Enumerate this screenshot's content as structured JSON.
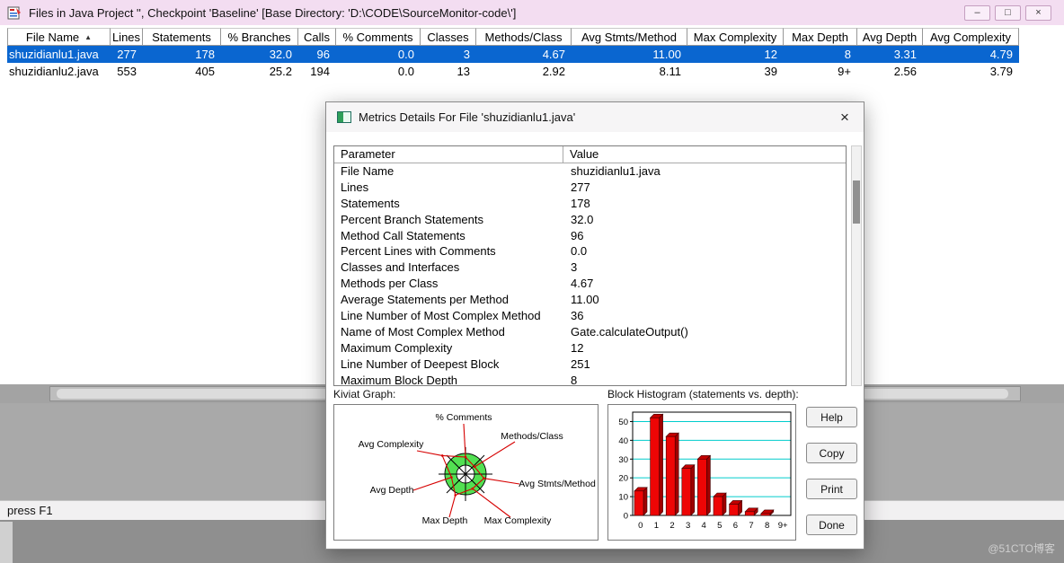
{
  "window": {
    "title": "Files in Java Project '', Checkpoint 'Baseline'  [Base Directory: 'D:\\CODE\\SourceMonitor-code\\']",
    "status": "press F1",
    "controls": {
      "minimize": "–",
      "maximize": "□",
      "close": "×"
    }
  },
  "icons": {
    "dialog_close": "×"
  },
  "file_table": {
    "sort_indicator": "▲",
    "columns": [
      "File Name",
      "Lines",
      "Statements",
      "% Branches",
      "Calls",
      "% Comments",
      "Classes",
      "Methods/Class",
      "Avg Stmts/Method",
      "Max Complexity",
      "Max Depth",
      "Avg Depth",
      "Avg Complexity"
    ],
    "rows": [
      {
        "selected": true,
        "cells": [
          "shuzidianlu1.java",
          "277",
          "178",
          "32.0",
          "96",
          "0.0",
          "3",
          "4.67",
          "11.00",
          "12",
          "8",
          "3.31",
          "4.79"
        ]
      },
      {
        "selected": false,
        "cells": [
          "shuzidianlu2.java",
          "553",
          "405",
          "25.2",
          "194",
          "0.0",
          "13",
          "2.92",
          "8.11",
          "39",
          "9+",
          "2.56",
          "3.79"
        ]
      }
    ]
  },
  "dialog": {
    "title": "Metrics Details For File 'shuzidianlu1.java'",
    "param_table": {
      "columns": [
        "Parameter",
        "Value"
      ],
      "rows": [
        [
          "File Name",
          "shuzidianlu1.java"
        ],
        [
          "Lines",
          "277"
        ],
        [
          "Statements",
          "178"
        ],
        [
          "Percent Branch Statements",
          "32.0"
        ],
        [
          "Method Call Statements",
          "96"
        ],
        [
          "Percent Lines with Comments",
          "0.0"
        ],
        [
          "Classes and Interfaces",
          "3"
        ],
        [
          "Methods per Class",
          "4.67"
        ],
        [
          "Average Statements per Method",
          "11.00"
        ],
        [
          "Line Number of Most Complex Method",
          "36"
        ],
        [
          "Name of Most Complex Method",
          "Gate.calculateOutput()"
        ],
        [
          "Maximum Complexity",
          "12"
        ],
        [
          "Line Number of Deepest Block",
          "251"
        ],
        [
          "Maximum Block Depth",
          "8"
        ]
      ]
    },
    "kiviat": {
      "label": "Kiviat Graph:",
      "axes": [
        "% Comments",
        "Methods/Class",
        "Avg Stmts/Method",
        "Max Complexity",
        "Max Depth",
        "Avg Depth",
        "Avg Complexity"
      ]
    },
    "histogram": {
      "label": "Block Histogram (statements vs. depth):"
    },
    "buttons": [
      "Help",
      "Copy",
      "Print",
      "Done"
    ]
  },
  "chart_data": {
    "type": "bar",
    "title": "Block Histogram (statements vs. depth)",
    "categories": [
      "0",
      "1",
      "2",
      "3",
      "4",
      "5",
      "6",
      "7",
      "8",
      "9+"
    ],
    "values": [
      13,
      52,
      42,
      25,
      30,
      10,
      6,
      2,
      1,
      0
    ],
    "xlabel": "",
    "ylabel": "",
    "ylim": [
      0,
      55
    ],
    "yticks": [
      0,
      10,
      20,
      30,
      40,
      50
    ],
    "bar_color": "#ee0505",
    "grid_color": "#00cccc",
    "grid": "horizontal"
  },
  "watermark": "@51CTO博客"
}
